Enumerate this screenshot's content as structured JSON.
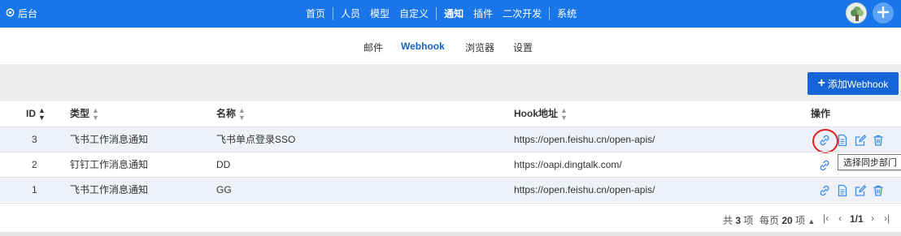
{
  "brand": {
    "label": "后台"
  },
  "topnav": {
    "items": [
      {
        "label": "首页"
      },
      {
        "label": "人员"
      },
      {
        "label": "模型"
      },
      {
        "label": "自定义"
      },
      {
        "label": "通知",
        "active": true
      },
      {
        "label": "插件"
      },
      {
        "label": "二次开发"
      },
      {
        "label": "系统"
      }
    ]
  },
  "subtabs": [
    {
      "label": "邮件"
    },
    {
      "label": "Webhook",
      "active": true
    },
    {
      "label": "浏览器"
    },
    {
      "label": "设置"
    }
  ],
  "toolbar": {
    "add_label": "添加Webhook"
  },
  "table": {
    "headers": {
      "id": "ID",
      "type": "类型",
      "name": "名称",
      "hook": "Hook地址",
      "ops": "操作"
    },
    "rows": [
      {
        "id": "3",
        "type": "飞书工作消息通知",
        "name": "飞书单点登录SSO",
        "hook": "https://open.feishu.cn/open-apis/"
      },
      {
        "id": "2",
        "type": "钉钉工作消息通知",
        "name": "DD",
        "hook": "https://oapi.dingtalk.com/"
      },
      {
        "id": "1",
        "type": "飞书工作消息通知",
        "name": "GG",
        "hook": "https://open.feishu.cn/open-apis/"
      }
    ]
  },
  "tooltip": {
    "text": "选择同步部门"
  },
  "pagination": {
    "total_prefix": "共",
    "total": "3",
    "total_suffix": "项",
    "per_page_prefix": "每页",
    "per_page": "20",
    "per_page_suffix": "项",
    "first": "|‹",
    "prev": "‹",
    "current": "1/1",
    "next": "›",
    "last": "›|"
  },
  "colors": {
    "primary": "#1976e8",
    "button": "#1565d8",
    "active_tab": "#1565c0",
    "icon": "#3a8ee6",
    "highlight": "#e02020"
  },
  "icons": {
    "brand": "gear-icon",
    "link": "link-icon",
    "doc": "document-icon",
    "edit": "edit-icon",
    "delete": "trash-icon",
    "add": "plus-icon"
  }
}
